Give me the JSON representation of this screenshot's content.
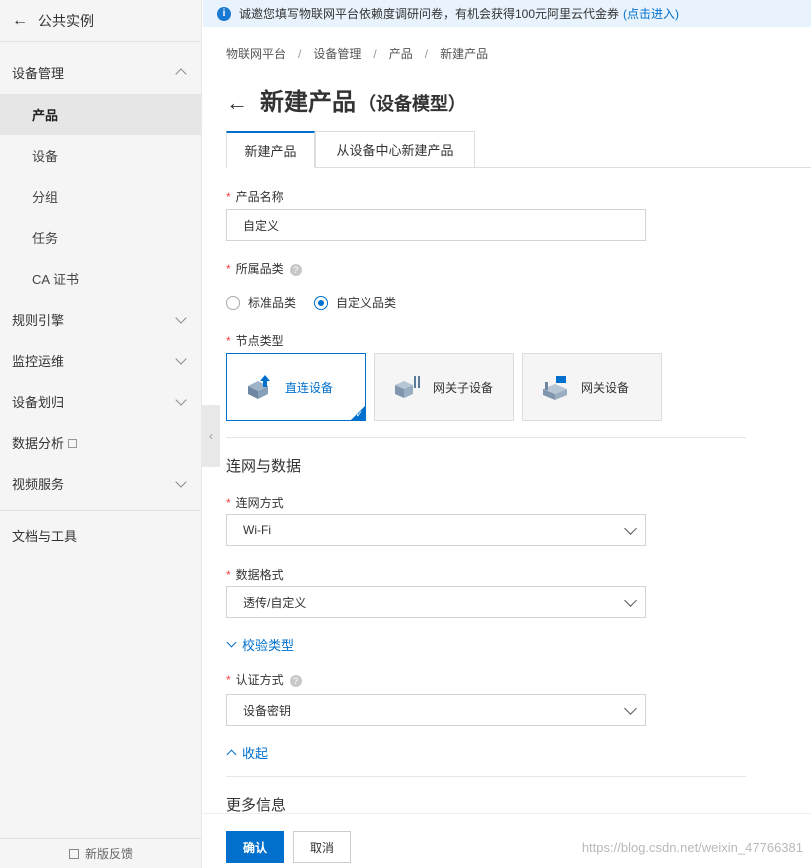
{
  "sidebar": {
    "back_label": "公共实例",
    "device_mgmt": "设备管理",
    "sub_items": [
      {
        "label": "产品"
      },
      {
        "label": "设备"
      },
      {
        "label": "分组"
      },
      {
        "label": "任务"
      },
      {
        "label": "CA 证书"
      }
    ],
    "groups": [
      {
        "label": "规则引擎"
      },
      {
        "label": "监控运维"
      },
      {
        "label": "设备划归"
      },
      {
        "label": "数据分析"
      },
      {
        "label": "视频服务"
      }
    ],
    "docs_tools": "文档与工具",
    "feedback": "新版反馈"
  },
  "banner": {
    "text": "诚邀您填写物联网平台依赖度调研问卷，有机会获得100元阿里云代金券",
    "link": "(点击进入)"
  },
  "breadcrumb": [
    "物联网平台",
    "设备管理",
    "产品",
    "新建产品"
  ],
  "page": {
    "title": "新建产品",
    "subtitle": "（设备模型）"
  },
  "tabs": [
    {
      "label": "新建产品"
    },
    {
      "label": "从设备中心新建产品"
    }
  ],
  "form": {
    "product_name_label": "产品名称",
    "product_name_value": "自定义",
    "category_label": "所属品类",
    "category_options": [
      "标准品类",
      "自定义品类"
    ],
    "category_selected": "自定义品类",
    "node_type_label": "节点类型",
    "node_types": [
      {
        "label": "直连设备",
        "icon": "direct-device-icon"
      },
      {
        "label": "网关子设备",
        "icon": "gateway-sub-device-icon"
      },
      {
        "label": "网关设备",
        "icon": "gateway-device-icon"
      }
    ],
    "section_network": "连网与数据",
    "network_label": "连网方式",
    "network_value": "Wi-Fi",
    "data_format_label": "数据格式",
    "data_format_value": "透传/自定义",
    "verify_type_link": "校验类型",
    "auth_label": "认证方式",
    "auth_value": "设备密钥",
    "collapse_link": "收起",
    "section_more": "更多信息"
  },
  "footer": {
    "confirm": "确认",
    "cancel": "取消",
    "watermark": "https://blog.csdn.net/weixin_47766381"
  },
  "colors": {
    "accent": "#0070cc",
    "required": "#ee4444",
    "banner_bg": "#e8f3fd"
  }
}
